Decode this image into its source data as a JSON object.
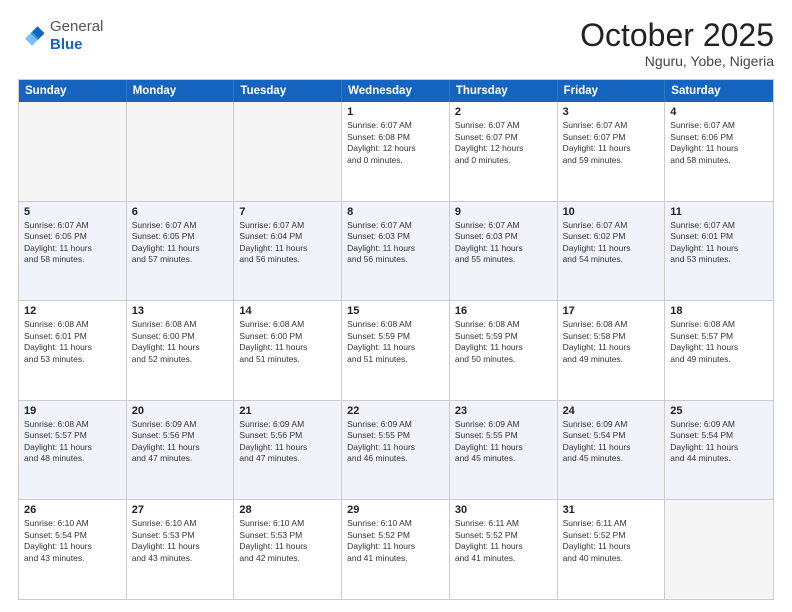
{
  "header": {
    "logo_general": "General",
    "logo_blue": "Blue",
    "month": "October 2025",
    "location": "Nguru, Yobe, Nigeria"
  },
  "days_of_week": [
    "Sunday",
    "Monday",
    "Tuesday",
    "Wednesday",
    "Thursday",
    "Friday",
    "Saturday"
  ],
  "rows": [
    [
      {
        "day": "",
        "text": "",
        "empty": true
      },
      {
        "day": "",
        "text": "",
        "empty": true
      },
      {
        "day": "",
        "text": "",
        "empty": true
      },
      {
        "day": "1",
        "text": "Sunrise: 6:07 AM\nSunset: 6:08 PM\nDaylight: 12 hours\nand 0 minutes."
      },
      {
        "day": "2",
        "text": "Sunrise: 6:07 AM\nSunset: 6:07 PM\nDaylight: 12 hours\nand 0 minutes."
      },
      {
        "day": "3",
        "text": "Sunrise: 6:07 AM\nSunset: 6:07 PM\nDaylight: 11 hours\nand 59 minutes."
      },
      {
        "day": "4",
        "text": "Sunrise: 6:07 AM\nSunset: 6:06 PM\nDaylight: 11 hours\nand 58 minutes."
      }
    ],
    [
      {
        "day": "5",
        "text": "Sunrise: 6:07 AM\nSunset: 6:05 PM\nDaylight: 11 hours\nand 58 minutes."
      },
      {
        "day": "6",
        "text": "Sunrise: 6:07 AM\nSunset: 6:05 PM\nDaylight: 11 hours\nand 57 minutes."
      },
      {
        "day": "7",
        "text": "Sunrise: 6:07 AM\nSunset: 6:04 PM\nDaylight: 11 hours\nand 56 minutes."
      },
      {
        "day": "8",
        "text": "Sunrise: 6:07 AM\nSunset: 6:03 PM\nDaylight: 11 hours\nand 56 minutes."
      },
      {
        "day": "9",
        "text": "Sunrise: 6:07 AM\nSunset: 6:03 PM\nDaylight: 11 hours\nand 55 minutes."
      },
      {
        "day": "10",
        "text": "Sunrise: 6:07 AM\nSunset: 6:02 PM\nDaylight: 11 hours\nand 54 minutes."
      },
      {
        "day": "11",
        "text": "Sunrise: 6:07 AM\nSunset: 6:01 PM\nDaylight: 11 hours\nand 53 minutes."
      }
    ],
    [
      {
        "day": "12",
        "text": "Sunrise: 6:08 AM\nSunset: 6:01 PM\nDaylight: 11 hours\nand 53 minutes."
      },
      {
        "day": "13",
        "text": "Sunrise: 6:08 AM\nSunset: 6:00 PM\nDaylight: 11 hours\nand 52 minutes."
      },
      {
        "day": "14",
        "text": "Sunrise: 6:08 AM\nSunset: 6:00 PM\nDaylight: 11 hours\nand 51 minutes."
      },
      {
        "day": "15",
        "text": "Sunrise: 6:08 AM\nSunset: 5:59 PM\nDaylight: 11 hours\nand 51 minutes."
      },
      {
        "day": "16",
        "text": "Sunrise: 6:08 AM\nSunset: 5:59 PM\nDaylight: 11 hours\nand 50 minutes."
      },
      {
        "day": "17",
        "text": "Sunrise: 6:08 AM\nSunset: 5:58 PM\nDaylight: 11 hours\nand 49 minutes."
      },
      {
        "day": "18",
        "text": "Sunrise: 6:08 AM\nSunset: 5:57 PM\nDaylight: 11 hours\nand 49 minutes."
      }
    ],
    [
      {
        "day": "19",
        "text": "Sunrise: 6:08 AM\nSunset: 5:57 PM\nDaylight: 11 hours\nand 48 minutes."
      },
      {
        "day": "20",
        "text": "Sunrise: 6:09 AM\nSunset: 5:56 PM\nDaylight: 11 hours\nand 47 minutes."
      },
      {
        "day": "21",
        "text": "Sunrise: 6:09 AM\nSunset: 5:56 PM\nDaylight: 11 hours\nand 47 minutes."
      },
      {
        "day": "22",
        "text": "Sunrise: 6:09 AM\nSunset: 5:55 PM\nDaylight: 11 hours\nand 46 minutes."
      },
      {
        "day": "23",
        "text": "Sunrise: 6:09 AM\nSunset: 5:55 PM\nDaylight: 11 hours\nand 45 minutes."
      },
      {
        "day": "24",
        "text": "Sunrise: 6:09 AM\nSunset: 5:54 PM\nDaylight: 11 hours\nand 45 minutes."
      },
      {
        "day": "25",
        "text": "Sunrise: 6:09 AM\nSunset: 5:54 PM\nDaylight: 11 hours\nand 44 minutes."
      }
    ],
    [
      {
        "day": "26",
        "text": "Sunrise: 6:10 AM\nSunset: 5:54 PM\nDaylight: 11 hours\nand 43 minutes."
      },
      {
        "day": "27",
        "text": "Sunrise: 6:10 AM\nSunset: 5:53 PM\nDaylight: 11 hours\nand 43 minutes."
      },
      {
        "day": "28",
        "text": "Sunrise: 6:10 AM\nSunset: 5:53 PM\nDaylight: 11 hours\nand 42 minutes."
      },
      {
        "day": "29",
        "text": "Sunrise: 6:10 AM\nSunset: 5:52 PM\nDaylight: 11 hours\nand 41 minutes."
      },
      {
        "day": "30",
        "text": "Sunrise: 6:11 AM\nSunset: 5:52 PM\nDaylight: 11 hours\nand 41 minutes."
      },
      {
        "day": "31",
        "text": "Sunrise: 6:11 AM\nSunset: 5:52 PM\nDaylight: 11 hours\nand 40 minutes."
      },
      {
        "day": "",
        "text": "",
        "empty": true
      }
    ]
  ]
}
